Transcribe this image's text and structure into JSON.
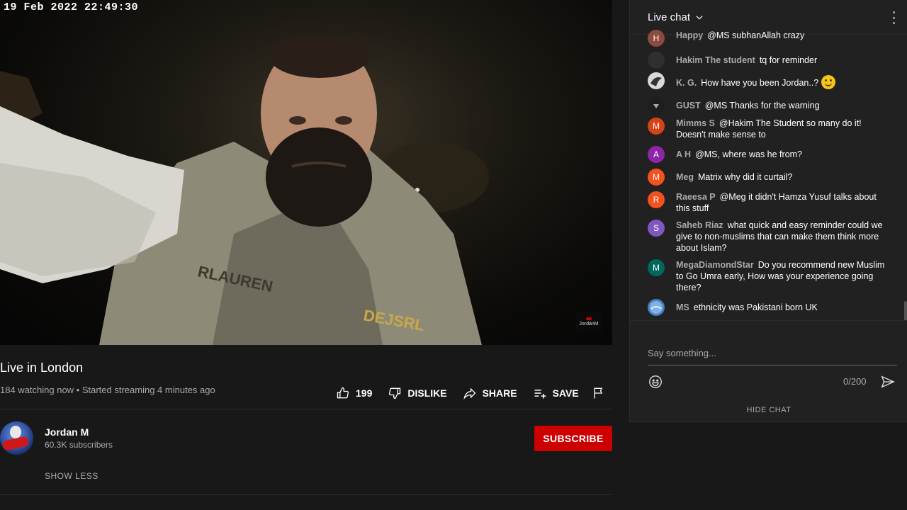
{
  "video": {
    "timestamp_overlay": "19 Feb 2022 22:49:30",
    "watermark": "JordanM",
    "title": "Live in London",
    "meta": "184 watching now • Started streaming 4 minutes ago",
    "actions": {
      "like_count": "199",
      "dislike_label": "DISLIKE",
      "share_label": "SHARE",
      "save_label": "SAVE"
    }
  },
  "channel": {
    "name": "Jordan M",
    "subscribers": "60.3K subscribers",
    "subscribe_label": "SUBSCRIBE",
    "show_less_label": "SHOW LESS"
  },
  "chat": {
    "title": "Live chat",
    "messages": [
      {
        "author": "Happy",
        "text": "@MS subhanAllah crazy",
        "avatar_letter": "H",
        "avatar_color": "#8d4b3e"
      },
      {
        "author": "Hakim The student",
        "text": "tq for reminder",
        "avatar_letter": "",
        "avatar_color": "#2f2f2f"
      },
      {
        "author": "K. G.",
        "text": "How have you been Jordan..?",
        "avatar_letter": "",
        "avatar_color": "#d9d9d9",
        "emoji": "slightly-smiling-face"
      },
      {
        "author": "GUST",
        "text": "@MS Thanks for the warning",
        "avatar_letter": "",
        "avatar_color": "#1e1e1e"
      },
      {
        "author": "Mimms S",
        "text": "@Hakim The Student so many do it! Doesn't make sense to",
        "avatar_letter": "M",
        "avatar_color": "#d84315"
      },
      {
        "author": "A H",
        "text": "@MS, where was he from?",
        "avatar_letter": "A",
        "avatar_color": "#8e24aa"
      },
      {
        "author": "Meg",
        "text": "Matrix why did it curtail?",
        "avatar_letter": "M",
        "avatar_color": "#f4511e"
      },
      {
        "author": "Raeesa P",
        "text": "@Meg it didn't Hamza Yusuf talks about this stuff",
        "avatar_letter": "R",
        "avatar_color": "#f4511e"
      },
      {
        "author": "Saheb Riaz",
        "text": "what quick and easy reminder could we give to non-muslims that can make them think more about Islam?",
        "avatar_letter": "S",
        "avatar_color": "#7e57c2"
      },
      {
        "author": "MegaDiamondStar",
        "text": "Do you recommend new Muslim to Go Umra early, How was your experience going there?",
        "avatar_letter": "M",
        "avatar_color": "#00695c"
      },
      {
        "author": "MS",
        "text": "ethnicity was Pakistani born UK",
        "avatar_letter": "",
        "avatar_color": "#4a7fc1"
      }
    ],
    "input_placeholder": "Say something...",
    "char_count": "0/200",
    "hide_chat_label": "HIDE CHAT"
  }
}
